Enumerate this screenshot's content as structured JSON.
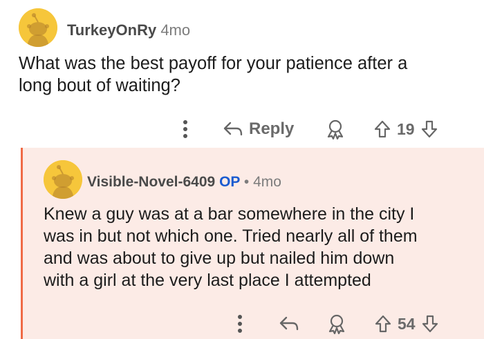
{
  "parent_comment": {
    "username": "TurkeyOnRy",
    "age": "4mo",
    "text_lines": [
      "What was the best payoff for your patience after a",
      "long bout of waiting?"
    ],
    "actions": {
      "more_icon": "vertical-ellipsis-icon",
      "reply_icon": "reply-arrow-icon",
      "reply_label": "Reply",
      "award_icon": "award-icon",
      "upvote_icon": "upvote-arrow-icon",
      "vote_count": "19",
      "downvote_icon": "downvote-arrow-icon"
    }
  },
  "reply_comment": {
    "username": "Visible-Novel-6409",
    "op_badge": "OP",
    "separator": "•",
    "age": "4mo",
    "text_lines": [
      "Knew a guy was at a bar somewhere in the city I",
      "was in but not which one. Tried nearly all of them",
      "and was about to give up but nailed him down",
      "with a girl at the very last place I attempted"
    ],
    "actions": {
      "more_icon": "vertical-ellipsis-icon",
      "reply_icon": "reply-arrow-icon",
      "award_icon": "award-icon",
      "upvote_icon": "upvote-arrow-icon",
      "vote_count": "54",
      "downvote_icon": "downvote-arrow-icon"
    }
  },
  "colors": {
    "avatar": "#f6c63b",
    "thread_line": "#f06a45",
    "reply_background": "#fcebe6",
    "op_badge": "#1a5bd0",
    "meta_text": "#7c7c7c",
    "action_text": "#6a6a6a"
  }
}
